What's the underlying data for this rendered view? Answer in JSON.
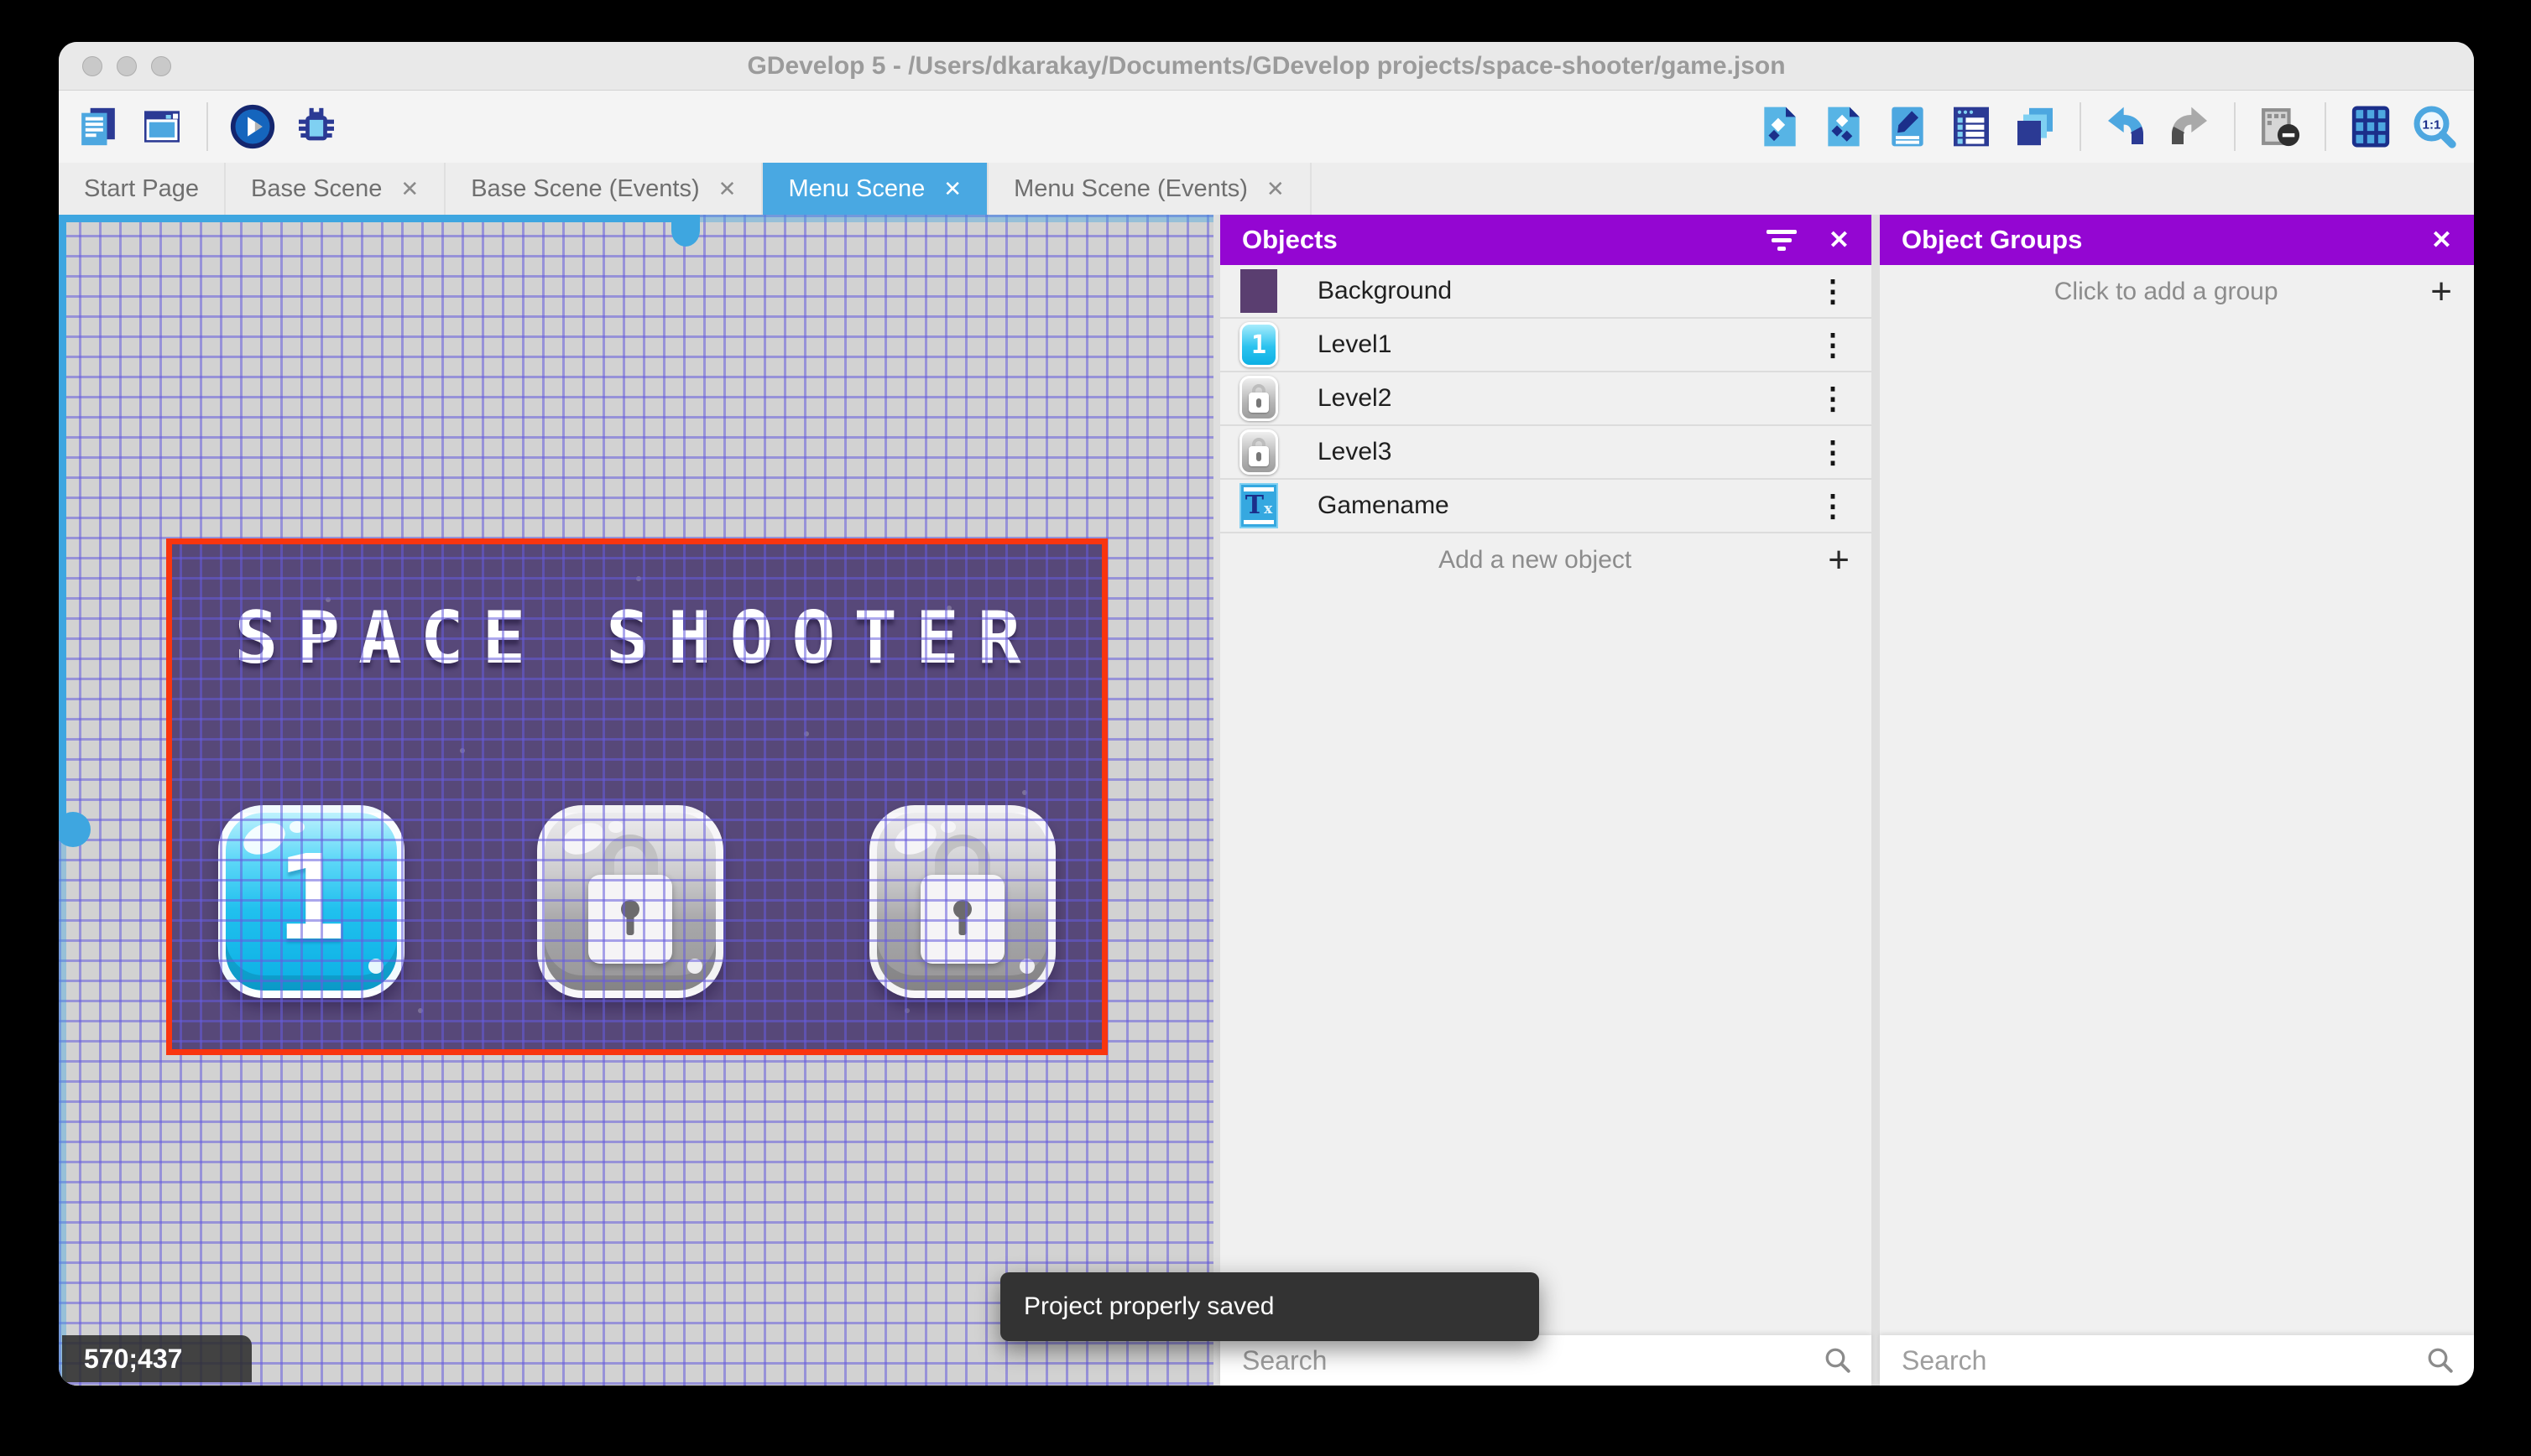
{
  "window": {
    "title": "GDevelop 5 - /Users/dkarakay/Documents/GDevelop projects/space-shooter/game.json"
  },
  "ui": {
    "close_symbol": "✕",
    "kebab_symbol": "⋮",
    "plus_symbol": "+"
  },
  "toolbar": {
    "left_icons": [
      "project-manager",
      "scene-window",
      "preview-play",
      "debug"
    ],
    "right_icons": [
      "objects-editor",
      "object-groups-editor",
      "properties",
      "instances-list",
      "layers",
      "undo",
      "redo",
      "window-mask",
      "grid",
      "zoom-1-1"
    ]
  },
  "tabs": [
    {
      "label": "Start Page",
      "closable": false,
      "active": false
    },
    {
      "label": "Base Scene",
      "closable": true,
      "active": false
    },
    {
      "label": "Base Scene (Events)",
      "closable": true,
      "active": false
    },
    {
      "label": "Menu Scene",
      "closable": true,
      "active": true
    },
    {
      "label": "Menu Scene (Events)",
      "closable": true,
      "active": false
    }
  ],
  "scene_canvas": {
    "coordinates": "570;437",
    "scene_title": "SPACE SHOOTER",
    "level_buttons": [
      {
        "name": "level1",
        "label": "1",
        "state": "unlocked"
      },
      {
        "name": "level2",
        "label": "",
        "state": "locked"
      },
      {
        "name": "level3",
        "label": "",
        "state": "locked"
      }
    ]
  },
  "objects_panel": {
    "title": "Objects",
    "items": [
      {
        "name": "Background",
        "icon": "background-thumbnail"
      },
      {
        "name": "Level1",
        "icon": "level1-button-thumbnail"
      },
      {
        "name": "Level2",
        "icon": "locked-button-thumbnail"
      },
      {
        "name": "Level3",
        "icon": "locked-button-thumbnail"
      },
      {
        "name": "Gamename",
        "icon": "text-object-thumbnail"
      }
    ],
    "add_button_label": "Add a new object",
    "search_placeholder": "Search"
  },
  "object_groups_panel": {
    "title": "Object Groups",
    "add_group_label": "Click to add a group",
    "search_placeholder": "Search"
  },
  "toast": {
    "message": "Project properly saved"
  },
  "colors": {
    "panel_header_purple": "#9406d2",
    "active_tab_blue": "#49a8e2",
    "selection_red": "#f9350f",
    "scene_purple": "#574879",
    "scrollbar_blue": "#3ea6e0"
  }
}
